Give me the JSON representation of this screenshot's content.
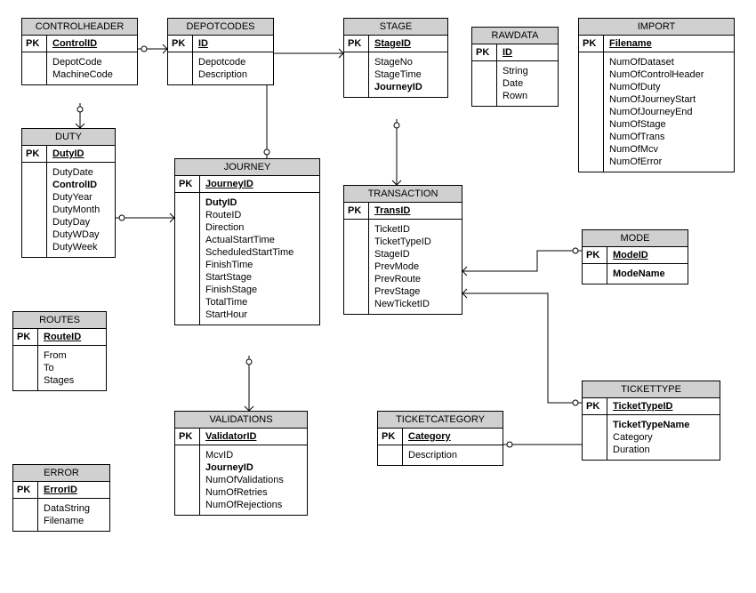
{
  "entities": {
    "controlheader": {
      "title": "CONTROLHEADER",
      "pk_label": "PK",
      "pk_name": "ControlID",
      "attrs": [
        "DepotCode",
        "MachineCode"
      ]
    },
    "depotcodes": {
      "title": "DEPOTCODES",
      "pk_label": "PK",
      "pk_name": "ID",
      "attrs": [
        "Depotcode",
        "Description"
      ]
    },
    "stage": {
      "title": "STAGE",
      "pk_label": "PK",
      "pk_name": "StageID",
      "attrs": [
        "StageNo",
        "StageTime"
      ],
      "fks": [
        "JourneyID"
      ]
    },
    "rawdata": {
      "title": "RAWDATA",
      "pk_label": "PK",
      "pk_name": "ID",
      "attrs": [
        "String",
        "Date",
        "Rown"
      ]
    },
    "import": {
      "title": "IMPORT",
      "pk_label": "PK",
      "pk_name": "Filename",
      "attrs": [
        "NumOfDataset",
        "NumOfControlHeader",
        "NumOfDuty",
        "NumOfJourneyStart",
        "NumOfJourneyEnd",
        "NumOfStage",
        "NumOfTrans",
        "NumOfMcv",
        "NumOfError"
      ]
    },
    "duty": {
      "title": "DUTY",
      "pk_label": "PK",
      "pk_name": "DutyID",
      "attrs_pre": [
        "DutyDate"
      ],
      "fks": [
        "ControlID"
      ],
      "attrs_post": [
        "DutyYear",
        "DutyMonth",
        "DutyDay",
        "DutyWDay",
        "DutyWeek"
      ]
    },
    "journey": {
      "title": "JOURNEY",
      "pk_label": "PK",
      "pk_name": "JourneyID",
      "fks": [
        "DutyID"
      ],
      "attrs": [
        "RouteID",
        "Direction",
        "ActualStartTime",
        "ScheduledStartTime",
        "FinishTime",
        "StartStage",
        "FinishStage",
        "TotalTime",
        "StartHour"
      ]
    },
    "routes": {
      "title": "ROUTES",
      "pk_label": "PK",
      "pk_name": "RouteID",
      "attrs": [
        "From",
        "To",
        "Stages"
      ]
    },
    "validations": {
      "title": "VALIDATIONS",
      "pk_label": "PK",
      "pk_name": "ValidatorID",
      "attrs_pre": [
        "McvID"
      ],
      "fks": [
        "JourneyID"
      ],
      "attrs_post": [
        "NumOfValidations",
        "NumOfRetries",
        "NumOfRejections"
      ]
    },
    "error": {
      "title": "ERROR",
      "pk_label": "PK",
      "pk_name": "ErrorID",
      "attrs": [
        "DataString",
        "Filename"
      ]
    },
    "transaction": {
      "title": "TRANSACTION",
      "pk_label": "PK",
      "pk_name": "TransID",
      "attrs": [
        "TicketID",
        "TicketTypeID",
        "StageID",
        "PrevMode",
        "PrevRoute",
        "PrevStage",
        "NewTicketID"
      ]
    },
    "mode": {
      "title": "MODE",
      "pk_label": "PK",
      "pk_name": "ModeID",
      "attrs": [],
      "fks": [
        "ModeName"
      ]
    },
    "ticketcategory": {
      "title": "TICKETCATEGORY",
      "pk_label": "PK",
      "pk_name": "Category",
      "attrs": [
        "Description"
      ]
    },
    "tickettype": {
      "title": "TICKETTYPE",
      "pk_label": "PK",
      "pk_name": "TicketTypeID",
      "fks": [
        "TicketTypeName"
      ],
      "attrs": [
        "Category",
        "Duration"
      ]
    }
  }
}
